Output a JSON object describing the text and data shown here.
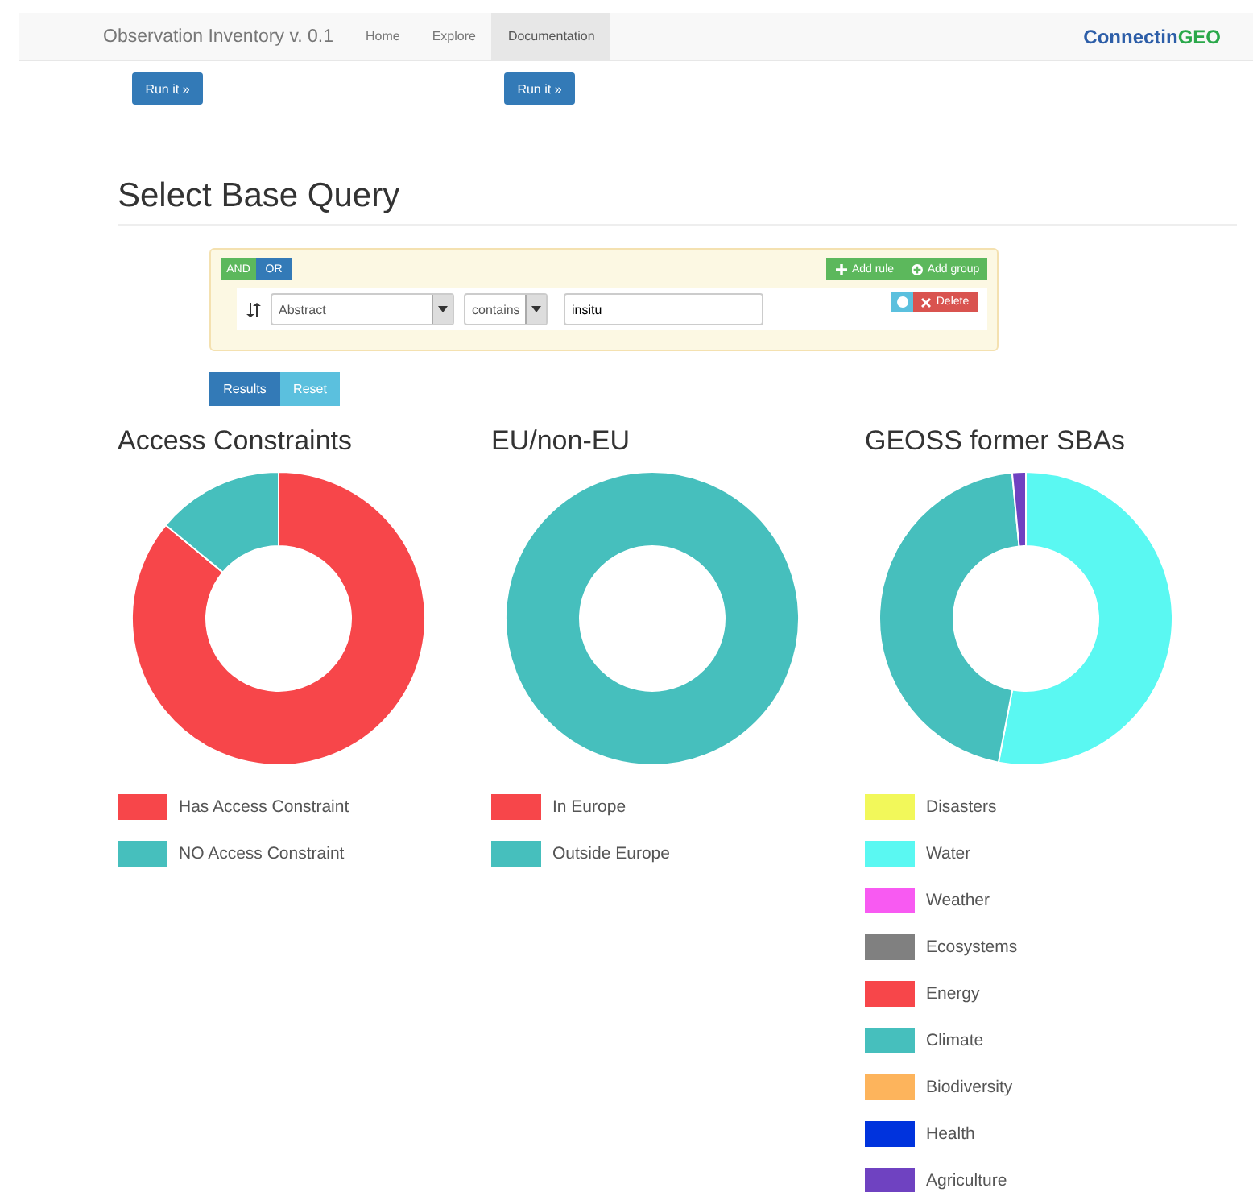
{
  "navbar": {
    "brand": "Observation Inventory v. 0.1",
    "links": [
      {
        "label": "Home",
        "selected": false
      },
      {
        "label": "Explore",
        "selected": false
      },
      {
        "label": "Documentation",
        "selected": true
      }
    ],
    "logo": {
      "text": "Connectin",
      "accent": "GEO"
    }
  },
  "run_buttons": [
    "Run it »",
    "Run it »"
  ],
  "heading": "Select Base Query",
  "query_builder": {
    "conditions": [
      {
        "label": "AND",
        "selected": true
      },
      {
        "label": "OR",
        "selected": false
      }
    ],
    "add_rule": "Add rule",
    "add_group": "Add group",
    "rule": {
      "field": "Abstract",
      "operator": "contains",
      "value": "insitu",
      "delete": "Delete"
    }
  },
  "actions": [
    {
      "label": "Results",
      "kind": "primary"
    },
    {
      "label": "Reset",
      "kind": "info"
    }
  ],
  "charts": [
    {
      "title": "Access Constraints",
      "legend": [
        {
          "label": "Has Access Constraint",
          "color": "#f7464a"
        },
        {
          "label": "NO Access Constraint",
          "color": "#46bfbd"
        }
      ]
    },
    {
      "title": "EU/non-EU",
      "legend": [
        {
          "label": "In Europe",
          "color": "#f7464a"
        },
        {
          "label": "Outside Europe",
          "color": "#46bfbd"
        }
      ]
    },
    {
      "title": "GEOSS former SBAs",
      "legend": [
        {
          "label": "Disasters",
          "color": "#f2f85a"
        },
        {
          "label": "Water",
          "color": "#5af8f2"
        },
        {
          "label": "Weather",
          "color": "#f85af2"
        },
        {
          "label": "Ecosystems",
          "color": "#808080"
        },
        {
          "label": "Energy",
          "color": "#f7464a"
        },
        {
          "label": "Climate",
          "color": "#46bfbd"
        },
        {
          "label": "Biodiversity",
          "color": "#fdb45c"
        },
        {
          "label": "Health",
          "color": "#0033dd"
        },
        {
          "label": "Agriculture",
          "color": "#6f42c1"
        }
      ]
    }
  ]
}
